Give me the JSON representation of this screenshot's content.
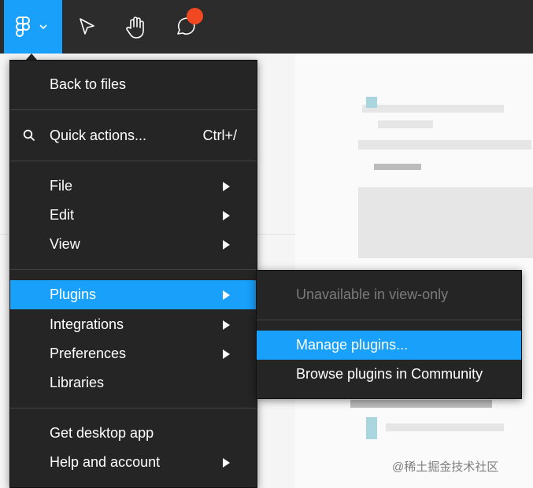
{
  "toolbar": {
    "icons": [
      "figma-logo-icon",
      "chevron-down-icon",
      "move-arrow-icon",
      "hand-icon",
      "comment-icon"
    ]
  },
  "main_menu": {
    "back_to_files": "Back to files",
    "quick_actions": "Quick actions...",
    "quick_actions_shortcut": "Ctrl+/",
    "file": "File",
    "edit": "Edit",
    "view": "View",
    "plugins": "Plugins",
    "integrations": "Integrations",
    "preferences": "Preferences",
    "libraries": "Libraries",
    "get_desktop_app": "Get desktop app",
    "help_and_account": "Help and account"
  },
  "plugins_submenu": {
    "unavailable": "Unavailable in view-only",
    "manage_plugins": "Manage plugins...",
    "browse_plugins": "Browse plugins in Community"
  },
  "watermark": "@稀土掘金技术社区",
  "colors": {
    "toolbar_bg": "#2c2c2c",
    "accent": "#18a0fb",
    "menu_bg": "#252525",
    "notification": "#f24822"
  }
}
